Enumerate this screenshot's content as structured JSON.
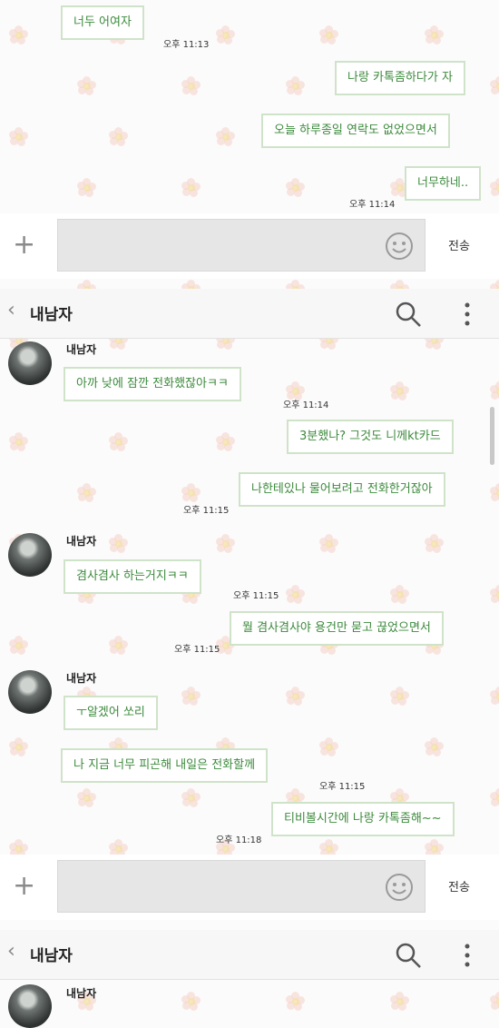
{
  "colors": {
    "bubble_border": "#cfe3c9",
    "bubble_text": "#3c8a3c",
    "input_bg": "#e6e6e6"
  },
  "chat_partner": "내남자",
  "input_bar": {
    "send_label": "전송",
    "plus_icon": "plus-icon",
    "emoji_icon": "smiley-icon"
  },
  "header": {
    "title": "내남자",
    "back_icon": "chevron-left-icon",
    "search_icon": "search-icon",
    "menu_icon": "more-vertical-icon"
  },
  "segment1": {
    "messages": [
      {
        "text": "너두 어여자",
        "time": "오후 11:13"
      },
      {
        "text": "나랑 카톡좀하다가 자"
      },
      {
        "text": "오늘 하루종일 연락도 없었으면서"
      },
      {
        "text": "너무하네..",
        "time": "오후 11:14"
      }
    ]
  },
  "segment2": {
    "messages": [
      {
        "sender": "내남자",
        "text": "아까 낮에 잠깐 전화했잖아ㅋㅋ",
        "time": "오후 11:14"
      },
      {
        "text": "3분했나? 그것도 니께kt카드"
      },
      {
        "text": "나한테있나 물어보려고 전화한거잖아",
        "time": "오후 11:15"
      },
      {
        "sender": "내남자",
        "text": "겸사겸사 하는거지ㅋㅋ",
        "time": "오후 11:15"
      },
      {
        "text": "뭘 겸사겸사야 용건만 묻고 끊었으면서",
        "time": "오후 11:15"
      },
      {
        "sender": "내남자",
        "text": "ㅜ알겠어 쏘리"
      },
      {
        "text": "나 지금 너무 피곤해 내일은 전화할께",
        "time": "오후 11:15"
      },
      {
        "text": "티비볼시간에 나랑 카톡좀해~~",
        "time": "오후 11:18"
      }
    ]
  },
  "segment3": {
    "sender": "내남자"
  }
}
